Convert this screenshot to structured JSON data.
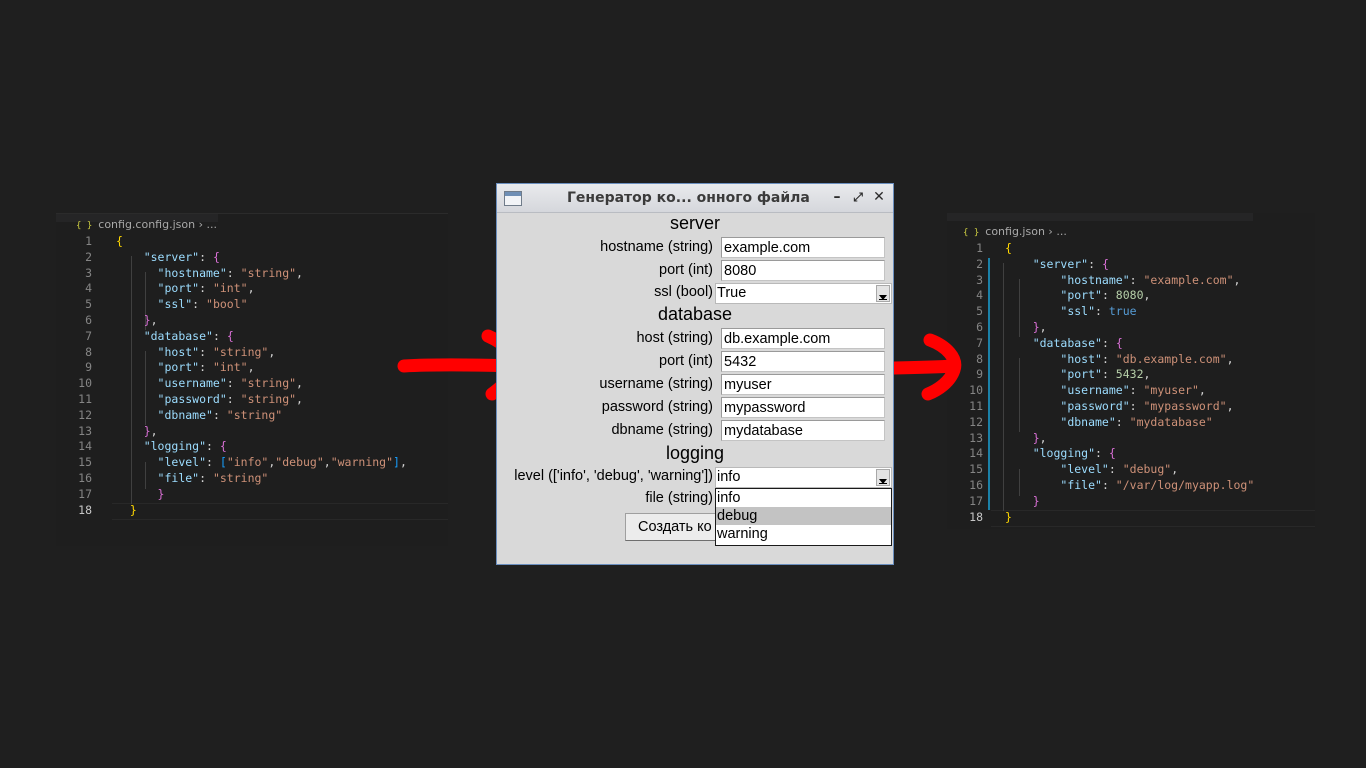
{
  "left_editor": {
    "breadcrumb": {
      "file": "config.config.json",
      "sep": "›",
      "more": "..."
    },
    "lines": [
      {
        "n": "1",
        "parts": [
          [
            "br1",
            "{"
          ]
        ]
      },
      {
        "n": "2",
        "parts": [
          [
            "p",
            "    "
          ],
          [
            "k",
            "\"server\""
          ],
          [
            "p",
            ": "
          ],
          [
            "br2",
            "{"
          ]
        ]
      },
      {
        "n": "3",
        "parts": [
          [
            "p",
            "      "
          ],
          [
            "k",
            "\"hostname\""
          ],
          [
            "p",
            ": "
          ],
          [
            "s",
            "\"string\""
          ],
          [
            "p",
            ","
          ]
        ]
      },
      {
        "n": "4",
        "parts": [
          [
            "p",
            "      "
          ],
          [
            "k",
            "\"port\""
          ],
          [
            "p",
            ": "
          ],
          [
            "s",
            "\"int\""
          ],
          [
            "p",
            ","
          ]
        ]
      },
      {
        "n": "5",
        "parts": [
          [
            "p",
            "      "
          ],
          [
            "k",
            "\"ssl\""
          ],
          [
            "p",
            ": "
          ],
          [
            "s",
            "\"bool\""
          ]
        ]
      },
      {
        "n": "6",
        "parts": [
          [
            "p",
            "    "
          ],
          [
            "br2",
            "}"
          ],
          [
            "p",
            ","
          ]
        ]
      },
      {
        "n": "7",
        "parts": [
          [
            "p",
            "    "
          ],
          [
            "k",
            "\"database\""
          ],
          [
            "p",
            ": "
          ],
          [
            "br2",
            "{"
          ]
        ]
      },
      {
        "n": "8",
        "parts": [
          [
            "p",
            "      "
          ],
          [
            "k",
            "\"host\""
          ],
          [
            "p",
            ": "
          ],
          [
            "s",
            "\"string\""
          ],
          [
            "p",
            ","
          ]
        ]
      },
      {
        "n": "9",
        "parts": [
          [
            "p",
            "      "
          ],
          [
            "k",
            "\"port\""
          ],
          [
            "p",
            ": "
          ],
          [
            "s",
            "\"int\""
          ],
          [
            "p",
            ","
          ]
        ]
      },
      {
        "n": "10",
        "parts": [
          [
            "p",
            "      "
          ],
          [
            "k",
            "\"username\""
          ],
          [
            "p",
            ": "
          ],
          [
            "s",
            "\"string\""
          ],
          [
            "p",
            ","
          ]
        ]
      },
      {
        "n": "11",
        "parts": [
          [
            "p",
            "      "
          ],
          [
            "k",
            "\"password\""
          ],
          [
            "p",
            ": "
          ],
          [
            "s",
            "\"string\""
          ],
          [
            "p",
            ","
          ]
        ]
      },
      {
        "n": "12",
        "parts": [
          [
            "p",
            "      "
          ],
          [
            "k",
            "\"dbname\""
          ],
          [
            "p",
            ": "
          ],
          [
            "s",
            "\"string\""
          ]
        ]
      },
      {
        "n": "13",
        "parts": [
          [
            "p",
            "    "
          ],
          [
            "br2",
            "}"
          ],
          [
            "p",
            ","
          ]
        ]
      },
      {
        "n": "14",
        "parts": [
          [
            "p",
            "    "
          ],
          [
            "k",
            "\"logging\""
          ],
          [
            "p",
            ": "
          ],
          [
            "br2",
            "{"
          ]
        ]
      },
      {
        "n": "15",
        "parts": [
          [
            "p",
            "      "
          ],
          [
            "k",
            "\"level\""
          ],
          [
            "p",
            ": "
          ],
          [
            "br3",
            "["
          ],
          [
            "s",
            "\"info\""
          ],
          [
            "p",
            ","
          ],
          [
            "s",
            "\"debug\""
          ],
          [
            "p",
            ","
          ],
          [
            "s",
            "\"warning\""
          ],
          [
            "br3",
            "]"
          ],
          [
            "p",
            ","
          ]
        ]
      },
      {
        "n": "16",
        "parts": [
          [
            "p",
            "      "
          ],
          [
            "k",
            "\"file\""
          ],
          [
            "p",
            ": "
          ],
          [
            "s",
            "\"string\""
          ]
        ]
      },
      {
        "n": "17",
        "parts": [
          [
            "p",
            "      "
          ],
          [
            "br2",
            "}"
          ]
        ]
      },
      {
        "n": "18",
        "parts": [
          [
            "p",
            "  "
          ],
          [
            "br1",
            "}"
          ]
        ]
      }
    ]
  },
  "right_editor": {
    "breadcrumb": {
      "file": "config.json",
      "sep": "›",
      "more": "..."
    },
    "lines": [
      {
        "n": "1",
        "parts": [
          [
            "br1",
            "{"
          ]
        ]
      },
      {
        "n": "2",
        "parts": [
          [
            "p",
            "    "
          ],
          [
            "k",
            "\"server\""
          ],
          [
            "p",
            ": "
          ],
          [
            "br2",
            "{"
          ]
        ]
      },
      {
        "n": "3",
        "parts": [
          [
            "p",
            "        "
          ],
          [
            "k",
            "\"hostname\""
          ],
          [
            "p",
            ": "
          ],
          [
            "s",
            "\"example.com\""
          ],
          [
            "p",
            ","
          ]
        ]
      },
      {
        "n": "4",
        "parts": [
          [
            "p",
            "        "
          ],
          [
            "k",
            "\"port\""
          ],
          [
            "p",
            ": "
          ],
          [
            "n",
            "8080"
          ],
          [
            "p",
            ","
          ]
        ]
      },
      {
        "n": "5",
        "parts": [
          [
            "p",
            "        "
          ],
          [
            "k",
            "\"ssl\""
          ],
          [
            "p",
            ": "
          ],
          [
            "b",
            "true"
          ]
        ]
      },
      {
        "n": "6",
        "parts": [
          [
            "p",
            "    "
          ],
          [
            "br2",
            "}"
          ],
          [
            "p",
            ","
          ]
        ]
      },
      {
        "n": "7",
        "parts": [
          [
            "p",
            "    "
          ],
          [
            "k",
            "\"database\""
          ],
          [
            "p",
            ": "
          ],
          [
            "br2",
            "{"
          ]
        ]
      },
      {
        "n": "8",
        "parts": [
          [
            "p",
            "        "
          ],
          [
            "k",
            "\"host\""
          ],
          [
            "p",
            ": "
          ],
          [
            "s",
            "\"db.example.com\""
          ],
          [
            "p",
            ","
          ]
        ]
      },
      {
        "n": "9",
        "parts": [
          [
            "p",
            "        "
          ],
          [
            "k",
            "\"port\""
          ],
          [
            "p",
            ": "
          ],
          [
            "n",
            "5432"
          ],
          [
            "p",
            ","
          ]
        ]
      },
      {
        "n": "10",
        "parts": [
          [
            "p",
            "        "
          ],
          [
            "k",
            "\"username\""
          ],
          [
            "p",
            ": "
          ],
          [
            "s",
            "\"myuser\""
          ],
          [
            "p",
            ","
          ]
        ]
      },
      {
        "n": "11",
        "parts": [
          [
            "p",
            "        "
          ],
          [
            "k",
            "\"password\""
          ],
          [
            "p",
            ": "
          ],
          [
            "s",
            "\"mypassword\""
          ],
          [
            "p",
            ","
          ]
        ]
      },
      {
        "n": "12",
        "parts": [
          [
            "p",
            "        "
          ],
          [
            "k",
            "\"dbname\""
          ],
          [
            "p",
            ": "
          ],
          [
            "s",
            "\"mydatabase\""
          ]
        ]
      },
      {
        "n": "13",
        "parts": [
          [
            "p",
            "    "
          ],
          [
            "br2",
            "}"
          ],
          [
            "p",
            ","
          ]
        ]
      },
      {
        "n": "14",
        "parts": [
          [
            "p",
            "    "
          ],
          [
            "k",
            "\"logging\""
          ],
          [
            "p",
            ": "
          ],
          [
            "br2",
            "{"
          ]
        ]
      },
      {
        "n": "15",
        "parts": [
          [
            "p",
            "        "
          ],
          [
            "k",
            "\"level\""
          ],
          [
            "p",
            ": "
          ],
          [
            "s",
            "\"debug\""
          ],
          [
            "p",
            ","
          ]
        ]
      },
      {
        "n": "16",
        "parts": [
          [
            "p",
            "        "
          ],
          [
            "k",
            "\"file\""
          ],
          [
            "p",
            ": "
          ],
          [
            "s",
            "\"/var/log/myapp.log\""
          ]
        ]
      },
      {
        "n": "17",
        "parts": [
          [
            "p",
            "    "
          ],
          [
            "br2",
            "}"
          ]
        ]
      },
      {
        "n": "18",
        "parts": [
          [
            "br1",
            "}"
          ]
        ]
      }
    ]
  },
  "dialog": {
    "title": "Генератор ко... онного файла",
    "controls": {
      "minimize": "–",
      "maximize": "⤢",
      "close": "✕"
    },
    "sections": {
      "server": "server",
      "database": "database",
      "logging": "logging"
    },
    "fields": {
      "hostname": {
        "label": "hostname (string)",
        "value": "example.com"
      },
      "server_port": {
        "label": "port (int)",
        "value": "8080"
      },
      "ssl": {
        "label": "ssl (bool)",
        "value": "True"
      },
      "host": {
        "label": "host (string)",
        "value": "db.example.com"
      },
      "db_port": {
        "label": "port (int)",
        "value": "5432"
      },
      "username": {
        "label": "username (string)",
        "value": "myuser"
      },
      "password": {
        "label": "password (string)",
        "value": "mypassword"
      },
      "dbname": {
        "label": "dbname (string)",
        "value": "mydatabase"
      },
      "level": {
        "label": "level (['info', 'debug', 'warning'])",
        "value": "info"
      },
      "file": {
        "label": "file (string)",
        "value": ""
      }
    },
    "level_options": [
      "info",
      "debug",
      "warning"
    ],
    "level_highlighted": "debug",
    "create_button": "Создать ко"
  },
  "colors": {
    "arrow": "#ff0000",
    "accent": "#6b8fbf",
    "background": "#1f1f1f"
  }
}
